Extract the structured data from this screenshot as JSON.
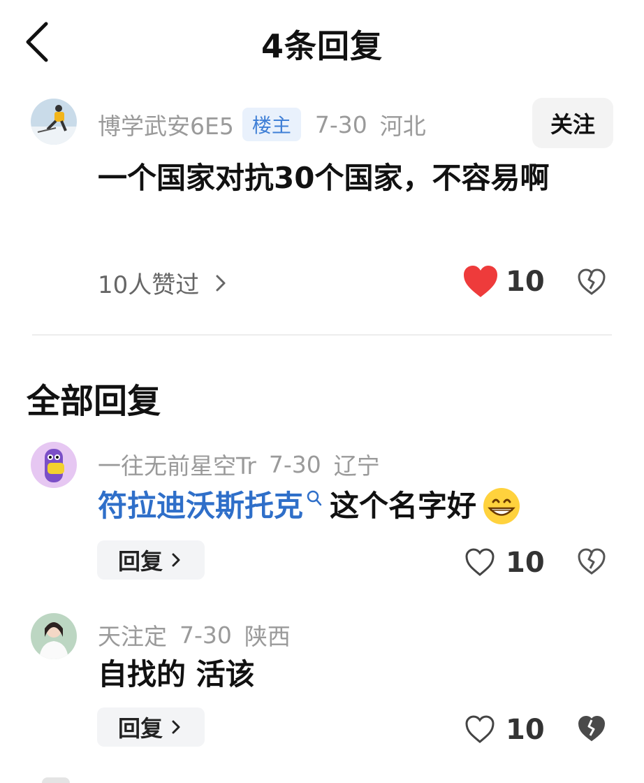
{
  "header": {
    "title": "4条回复",
    "back_icon": "chevron-left-icon"
  },
  "op_comment": {
    "username": "博学武安6E5",
    "badge": "楼主",
    "date": "7-30",
    "location": "河北",
    "follow_label": "关注",
    "content": "一个国家对抗30个国家，不容易啊",
    "likes_link": "10人赞过",
    "like_count": "10",
    "liked": true,
    "like_color": "#ee3b3b"
  },
  "section_title": "全部回复",
  "replies": [
    {
      "username": "一往无前星空Tr",
      "date": "7-30",
      "location": "辽宁",
      "mention": "符拉迪沃斯托克",
      "content": "这个名字好",
      "emoji": "grinning-face-emoji",
      "reply_label": "回复",
      "like_count": "10"
    },
    {
      "username": "天注定",
      "date": "7-30",
      "location": "陕西",
      "content": "自找的 活该",
      "reply_label": "回复",
      "like_count": "10"
    }
  ],
  "colors": {
    "mention": "#2f6fc9",
    "badge_bg": "#e9f1fc",
    "badge_text": "#3f7fd6"
  }
}
